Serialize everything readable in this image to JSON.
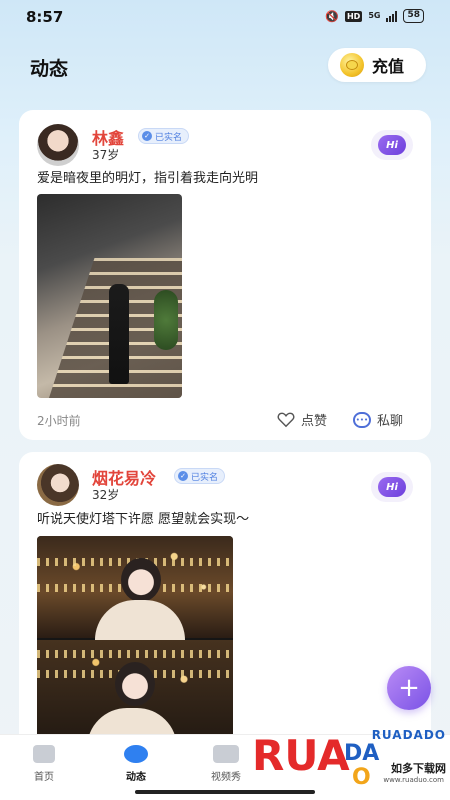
{
  "status_bar": {
    "time": "8:57",
    "network": "5G",
    "hd": "HD",
    "battery": "58"
  },
  "header": {
    "title": "动态",
    "recharge_label": "充值"
  },
  "posts": [
    {
      "username": "林鑫",
      "verified_label": "已实名",
      "age": "37岁",
      "text": "爱是暗夜里的明灯，指引着我走向光明",
      "time": "2小时前",
      "like_label": "点赞",
      "message_label": "私聊",
      "hi_label": "Hi"
    },
    {
      "username": "烟花易冷",
      "verified_label": "已实名",
      "age": "32岁",
      "text": "听说天使灯塔下许愿 愿望就会实现～",
      "hi_label": "Hi"
    }
  ],
  "fab_label": "+",
  "tabs": [
    {
      "label": "首页"
    },
    {
      "label": "动态"
    },
    {
      "label": "视频秀"
    }
  ],
  "watermark": {
    "brand": "RUADADO",
    "text": "如多下载网",
    "url": "www.ruaduo.com"
  },
  "colors": {
    "username": "#e2453b",
    "accent": "#2f80f0",
    "fab": "#7a52e6",
    "verified": "#4f7fe0"
  }
}
